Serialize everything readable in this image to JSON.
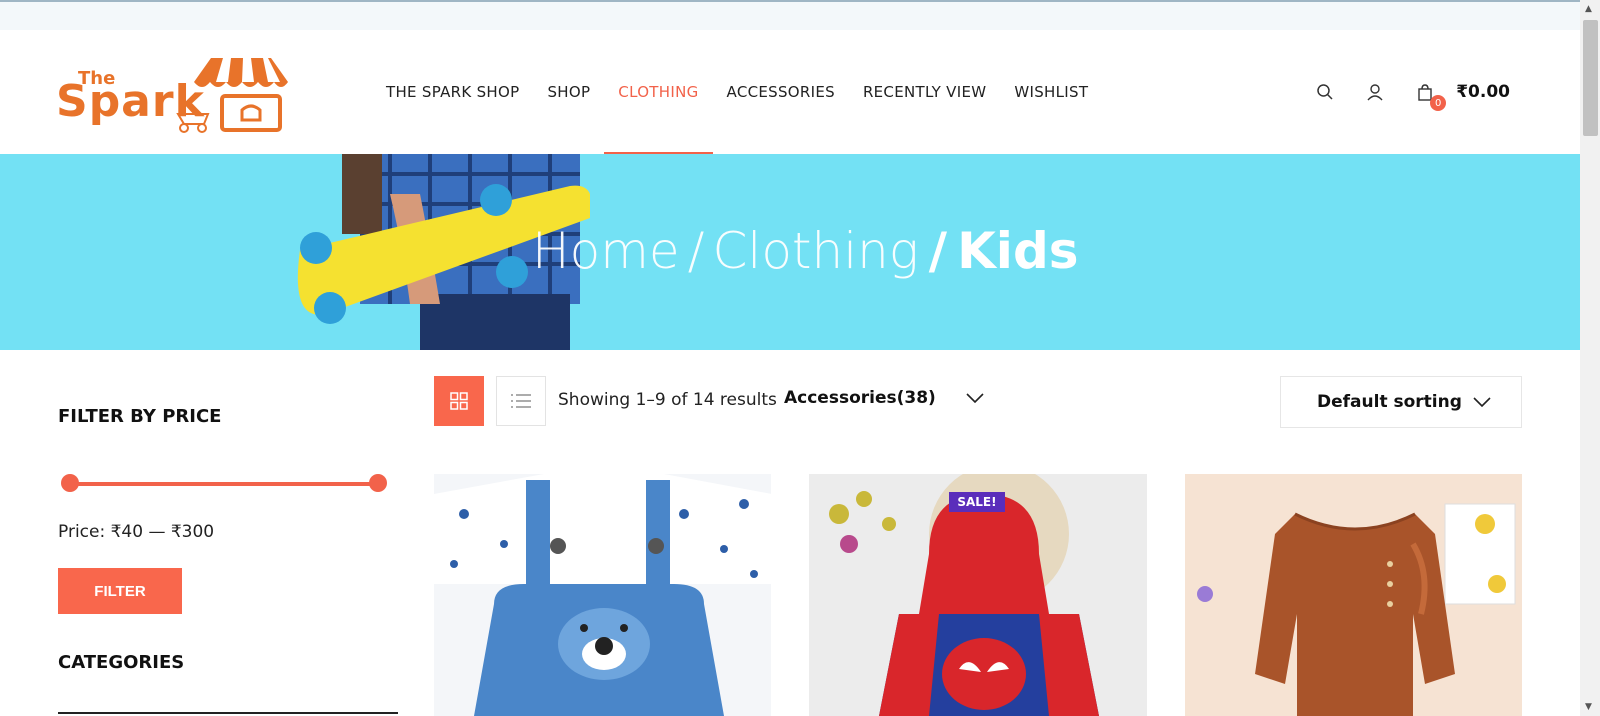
{
  "logo": {
    "line1": "The",
    "line2": "Spark"
  },
  "nav": {
    "items": [
      {
        "label": "THE SPARK SHOP"
      },
      {
        "label": "SHOP"
      },
      {
        "label": "CLOTHING",
        "active": true
      },
      {
        "label": "ACCESSORIES"
      },
      {
        "label": "RECENTLY VIEW"
      },
      {
        "label": "WISHLIST"
      }
    ]
  },
  "header": {
    "icons": [
      "search-icon",
      "user-icon",
      "bag-icon"
    ],
    "cart_count": "0",
    "cart_total": "₹0.00"
  },
  "banner": {
    "crumbs": [
      "Home",
      "Clothing"
    ],
    "current": "Kids"
  },
  "sidebar": {
    "filter_title": "FILTER BY PRICE",
    "price_label": "Price: ₹40 — ₹300",
    "price_range": [
      40,
      300
    ],
    "filter_button": "FILTER",
    "categories_title": "CATEGORIES"
  },
  "toolbar": {
    "result_count": "Showing 1–9 of 14 results",
    "category_select": "Accessories(38)",
    "sort_select": "Default sorting"
  },
  "products": [
    {
      "image": "kids-overall-outfit",
      "badge": ""
    },
    {
      "image": "spiderman-hoodie",
      "badge": "SALE!"
    },
    {
      "image": "brown-ruffle-dress",
      "badge": ""
    }
  ],
  "colors": {
    "accent": "#f2624a",
    "banner": "#73e1f4",
    "sale": "#5a2dbb"
  }
}
